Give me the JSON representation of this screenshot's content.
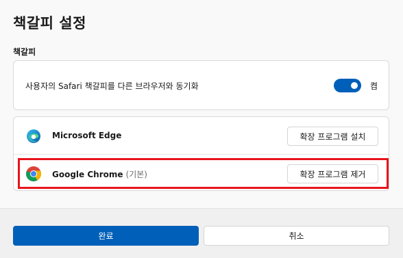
{
  "dialog": {
    "title": "책갈피 설정",
    "section_label": "책갈피"
  },
  "sync": {
    "label": "사용자의 Safari 책갈피를 다른 브라우저와 동기화",
    "toggle_on": true,
    "toggle_state_label": "켬"
  },
  "browsers": [
    {
      "name": "Microsoft Edge",
      "default_label": "",
      "icon": "edge-icon",
      "button_label": "확장 프로그램 설치"
    },
    {
      "name": "Google Chrome",
      "default_label": "(기본)",
      "icon": "chrome-icon",
      "button_label": "확장 프로그램 제거",
      "highlighted": true
    }
  ],
  "footer": {
    "confirm_label": "완료",
    "cancel_label": "취소"
  },
  "colors": {
    "accent": "#005fb8",
    "highlight": "#e8141b"
  }
}
